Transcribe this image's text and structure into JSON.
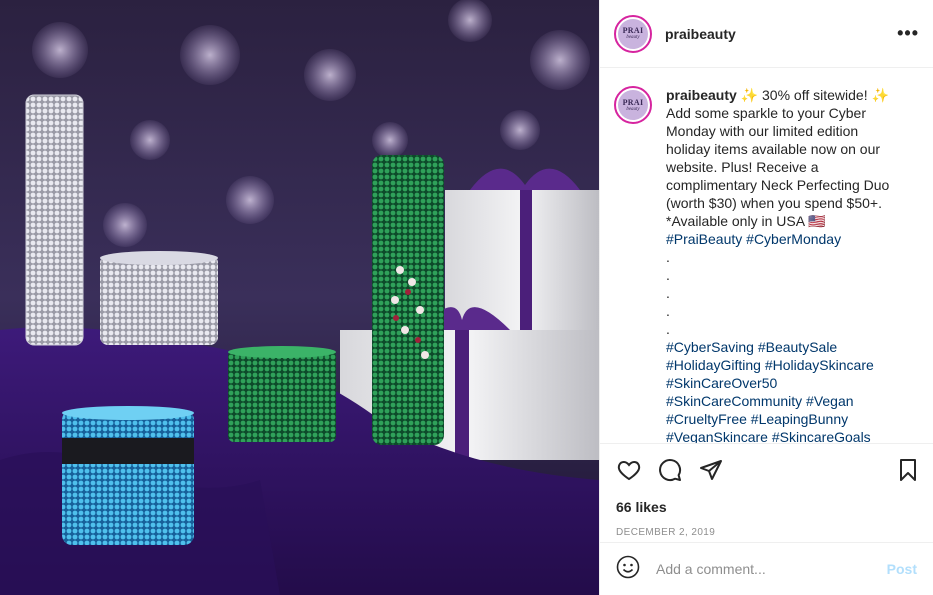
{
  "post": {
    "username": "praibeauty",
    "avatar_text": "PRAI",
    "avatar_subtext": "beauty",
    "more_label": "•••",
    "caption_lines": [
      {
        "text": " ✨ 30% off sitewide! ✨",
        "type": "text"
      },
      {
        "text": "Add some sparkle to your Cyber",
        "type": "text"
      },
      {
        "text": "Monday with our limited edition",
        "type": "text"
      },
      {
        "text": "holiday items available now on our",
        "type": "text"
      },
      {
        "text": "website. Plus! Receive a",
        "type": "text"
      },
      {
        "text": "complimentary Neck Perfecting Duo",
        "type": "text"
      },
      {
        "text": "(worth $30) when you spend $50+.",
        "type": "text"
      },
      {
        "text": "*Available only in USA 🇺🇸",
        "type": "text"
      },
      {
        "text": "#PraiBeauty #CyberMonday",
        "type": "tags"
      },
      {
        "text": ".",
        "type": "text"
      },
      {
        "text": ".",
        "type": "text"
      },
      {
        "text": ".",
        "type": "text"
      },
      {
        "text": ".",
        "type": "text"
      },
      {
        "text": ".",
        "type": "text"
      },
      {
        "text": "#CyberSaving #BeautySale",
        "type": "tags"
      },
      {
        "text": "#HolidayGifting #HolidaySkincare",
        "type": "tags"
      },
      {
        "text": "#SkinCareOver50",
        "type": "tags"
      },
      {
        "text": "#SkinCareCommunity #Vegan",
        "type": "tags"
      },
      {
        "text": "#CrueltyFree #LeapingBunny",
        "type": "tags"
      },
      {
        "text": "#VeganSkincare #SkincareGoals",
        "type": "tags"
      }
    ],
    "likes": "66 likes",
    "date": "DECEMBER 2, 2019",
    "comment_placeholder": "Add a comment...",
    "post_button": "Post",
    "icons": [
      "heart-icon",
      "comment-icon",
      "share-icon",
      "bookmark-icon",
      "emoji-icon"
    ]
  }
}
